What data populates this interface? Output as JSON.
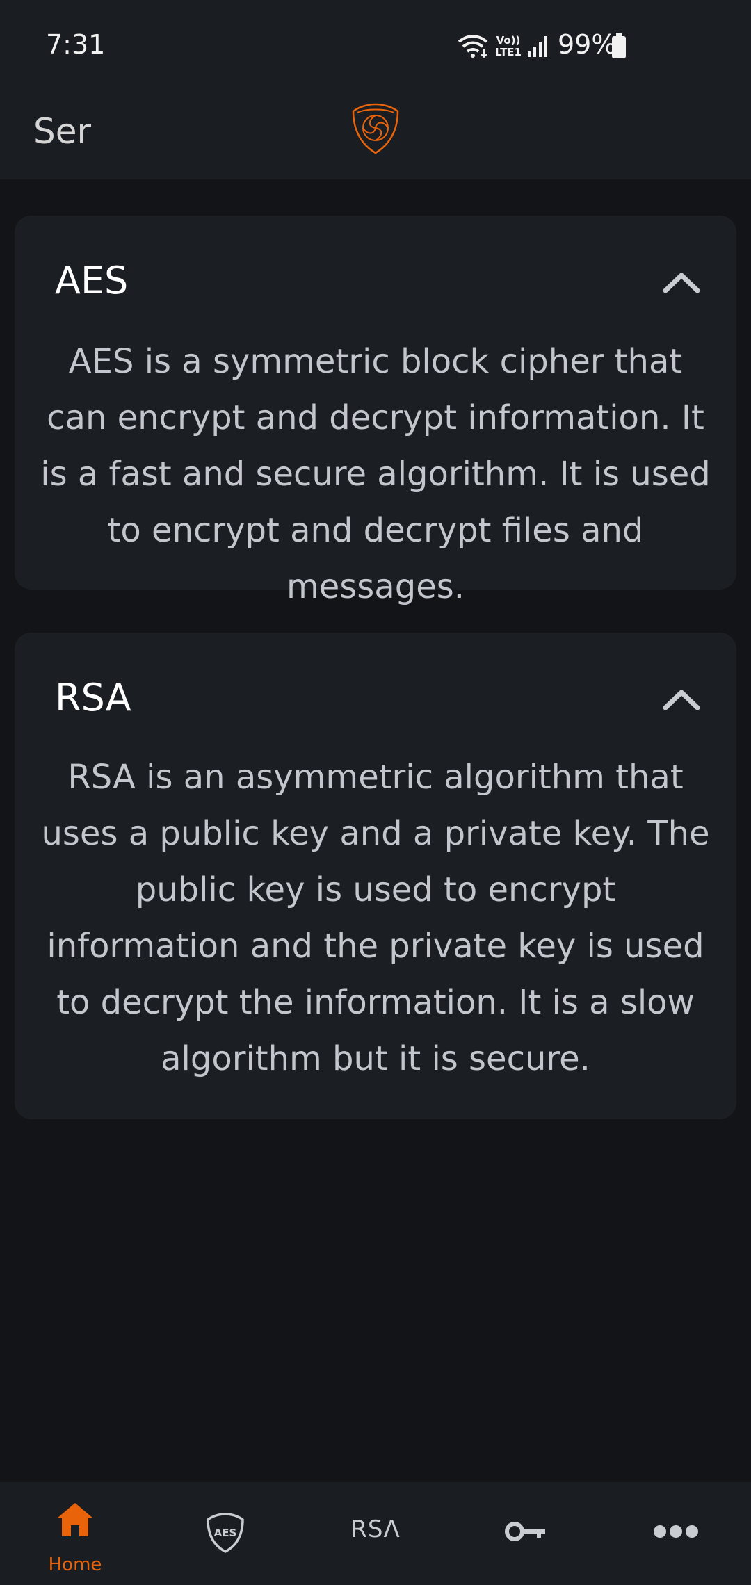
{
  "status_bar": {
    "time": "7:31",
    "battery": "99%",
    "icons": [
      "wifi-icon",
      "volte-icon",
      "signal-icon",
      "battery-icon"
    ],
    "volte_label_top": "Vo))",
    "volte_label_bottom": "LTE1"
  },
  "app_bar": {
    "title": "Ser",
    "logo": "app-shield-logo"
  },
  "sections": [
    {
      "title": "AES",
      "expanded": true,
      "body": "AES is a symmetric block cipher that can encrypt and decrypt information. It is a fast and secure algorithm. It is used to encrypt and decrypt files and messages."
    },
    {
      "title": "RSA",
      "expanded": true,
      "body": "RSA is an asymmetric algorithm that uses a public key and a private key. The public key is used to encrypt information and the private key is used to decrypt the information. It is a slow algorithm but it is secure."
    }
  ],
  "bottom_nav": {
    "items": [
      {
        "label": "Home",
        "icon": "home-icon",
        "active": true
      },
      {
        "label": "",
        "icon": "aes-shield-icon",
        "icon_text": "AES",
        "active": false
      },
      {
        "label": "",
        "icon": "rsa-icon",
        "icon_text": "RSΛ",
        "active": false
      },
      {
        "label": "",
        "icon": "key-icon",
        "active": false
      },
      {
        "label": "",
        "icon": "more-icon",
        "active": false
      }
    ]
  },
  "colors": {
    "accent": "#e8630a",
    "background": "#121418",
    "surface": "#1b1e23",
    "bar": "#1a1d22",
    "text_primary": "#ffffff",
    "text_secondary": "#c3c6cc"
  }
}
